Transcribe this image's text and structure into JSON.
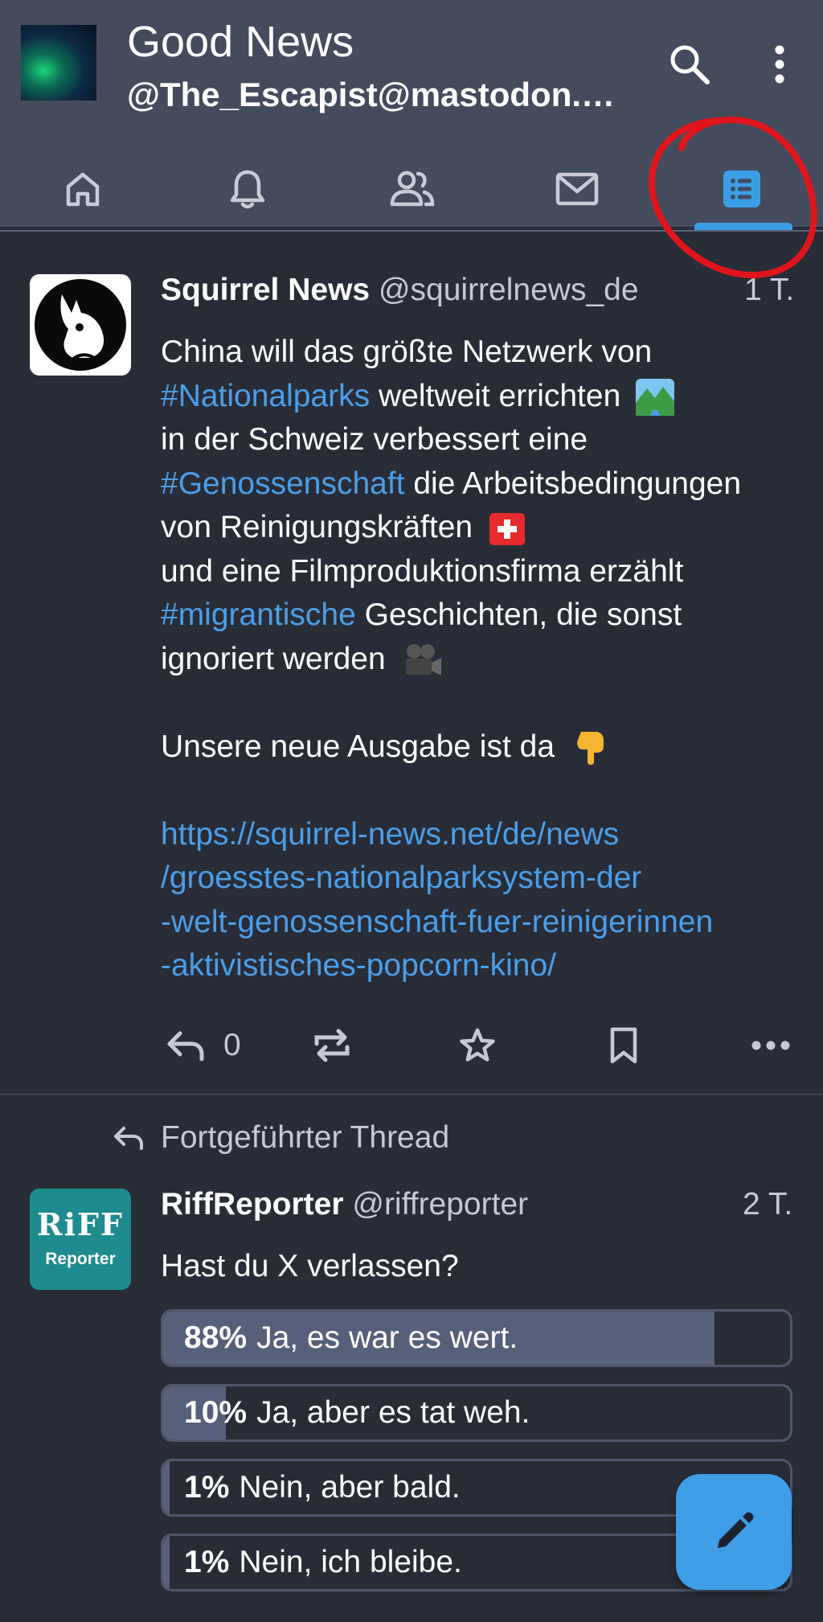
{
  "account": {
    "name": "Good News",
    "handle": "@The_Escapist@mastodon.so…"
  },
  "tabs": [
    {
      "id": "home",
      "icon": "home-icon"
    },
    {
      "id": "notifications",
      "icon": "bell-icon"
    },
    {
      "id": "local",
      "icon": "users-icon"
    },
    {
      "id": "messages",
      "icon": "mail-icon"
    },
    {
      "id": "lists",
      "icon": "list-icon",
      "active": true
    }
  ],
  "colors": {
    "accent": "#3a9ee6",
    "annotation": "#e0141b",
    "link": "#4a9ee8"
  },
  "post1": {
    "display_name": "Squirrel News",
    "handle": "@squirrelnews_de",
    "time": "1 T.",
    "l1": "China will das größte Netzwerk von",
    "l2_tag": "#Nationalparks",
    "l2_rest": " weltweit errichten",
    "l3": "in der Schweiz verbessert eine",
    "l4_tag": "#Genossenschaft",
    "l4_rest": " die Arbeitsbedingungen",
    "l5": "von Reinigungskräften",
    "l6": "und eine Filmproduktionsfirma erzählt",
    "l7_tag": "#migrantische",
    "l7_rest": " Geschichten, die sonst",
    "l8": "ignoriert werden",
    "l9": "Unsere neue Ausgabe ist da",
    "link1": "https://squirrel-news.net/de/news",
    "link2": "/groesstes-nationalparksystem-der",
    "link3": "-welt-genossenschaft-fuer-reinigerinnen",
    "link4": "-aktivistisches-popcorn-kino/",
    "reply_count": "0"
  },
  "thread_note": "Fortgeführter Thread",
  "post2": {
    "display_name": "RiffReporter",
    "handle": "@riffreporter",
    "time": "2 T.",
    "question": "Hast du X verlassen?",
    "avatar_top": "RiFF",
    "avatar_bottom": "Reporter"
  },
  "poll": [
    {
      "percent": "88%",
      "label": "Ja, es war es wert.",
      "value": 0.88
    },
    {
      "percent": "10%",
      "label": "Ja, aber es tat weh.",
      "value": 0.1
    },
    {
      "percent": "1%",
      "label": "Nein, aber bald.",
      "value": 0.01
    },
    {
      "percent": "1%",
      "label": "Nein, ich bleibe.",
      "value": 0.01
    }
  ]
}
